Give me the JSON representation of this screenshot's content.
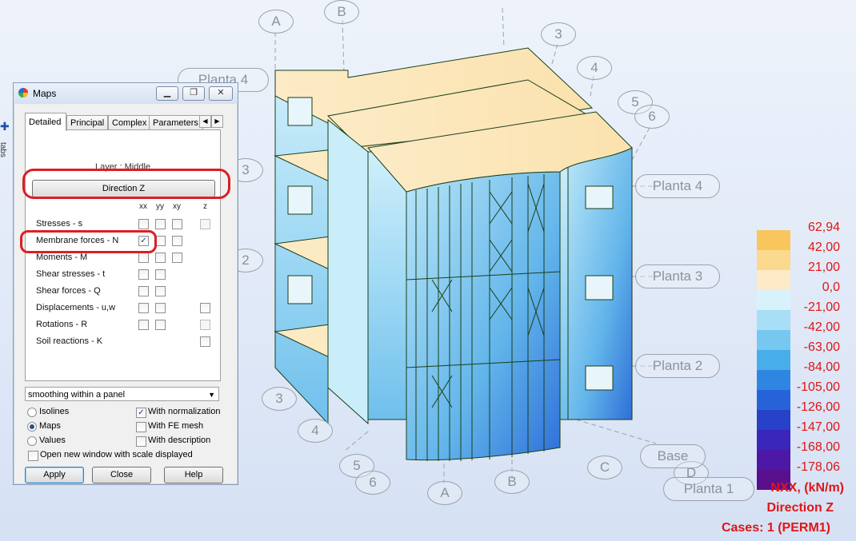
{
  "viewport": {
    "axis_labels": [
      "A",
      "B",
      "3",
      "4",
      "5",
      "6",
      "3",
      "2",
      "3",
      "4",
      "5",
      "6",
      "A",
      "B",
      "C",
      "D"
    ],
    "level_labels": [
      "Planta 4",
      "Planta 4",
      "Planta 3",
      "Planta 2",
      "Base",
      "Planta 1"
    ]
  },
  "legend": {
    "values": [
      "62,94",
      "42,00",
      "21,00",
      "0,0",
      "-21,00",
      "-42,00",
      "-63,00",
      "-84,00",
      "-105,00",
      "-126,00",
      "-147,00",
      "-168,00",
      "-178,06"
    ],
    "colors": [
      "#f9c65e",
      "#fbd98f",
      "#fcebc6",
      "#d8f2fb",
      "#a8def6",
      "#77c8f0",
      "#48aee9",
      "#2f86e0",
      "#2763d8",
      "#2841c9",
      "#3a26ba",
      "#4e18a6",
      "#5a0f8e"
    ],
    "quantity": "NXX, (kN/m)",
    "direction": "Direction Z",
    "cases": "Cases: 1 (PERM1)"
  },
  "side_tab": {
    "label": "tabs"
  },
  "dialog": {
    "title": "Maps",
    "tabs": [
      "Detailed",
      "Principal",
      "Complex",
      "Parameters"
    ],
    "active_tab": "Detailed",
    "layer_label": "Layer : Middle",
    "direction_button": "Direction Z",
    "columns": [
      "xx",
      "yy",
      "xy",
      "z"
    ],
    "rows": [
      {
        "label": "Stresses - s",
        "checks": [
          false,
          false,
          false,
          false
        ]
      },
      {
        "label": "Membrane forces - N",
        "checks": [
          true,
          false,
          false
        ]
      },
      {
        "label": "Moments - M",
        "checks": [
          false,
          false,
          false
        ]
      },
      {
        "label": "Shear stresses - t",
        "checks": [
          false,
          false
        ]
      },
      {
        "label": "Shear forces - Q",
        "checks": [
          false,
          false
        ]
      },
      {
        "label": "Displacements - u,w",
        "checks": [
          false,
          false,
          false
        ]
      },
      {
        "label": "Rotations - R",
        "checks": [
          false,
          false,
          false
        ]
      },
      {
        "label": "Soil reactions - K",
        "checks": [
          false
        ]
      }
    ],
    "smoothing": "smoothing within a panel",
    "display_mode": {
      "options": [
        "Isolines",
        "Maps",
        "Values"
      ],
      "selected": "Maps"
    },
    "options": [
      {
        "label": "With normalization",
        "checked": true
      },
      {
        "label": "With FE mesh",
        "checked": false
      },
      {
        "label": "With description",
        "checked": false
      }
    ],
    "open_new_window": {
      "label": "Open new window with scale displayed",
      "checked": false
    },
    "buttons": {
      "apply": "Apply",
      "close": "Close",
      "help": "Help"
    }
  }
}
